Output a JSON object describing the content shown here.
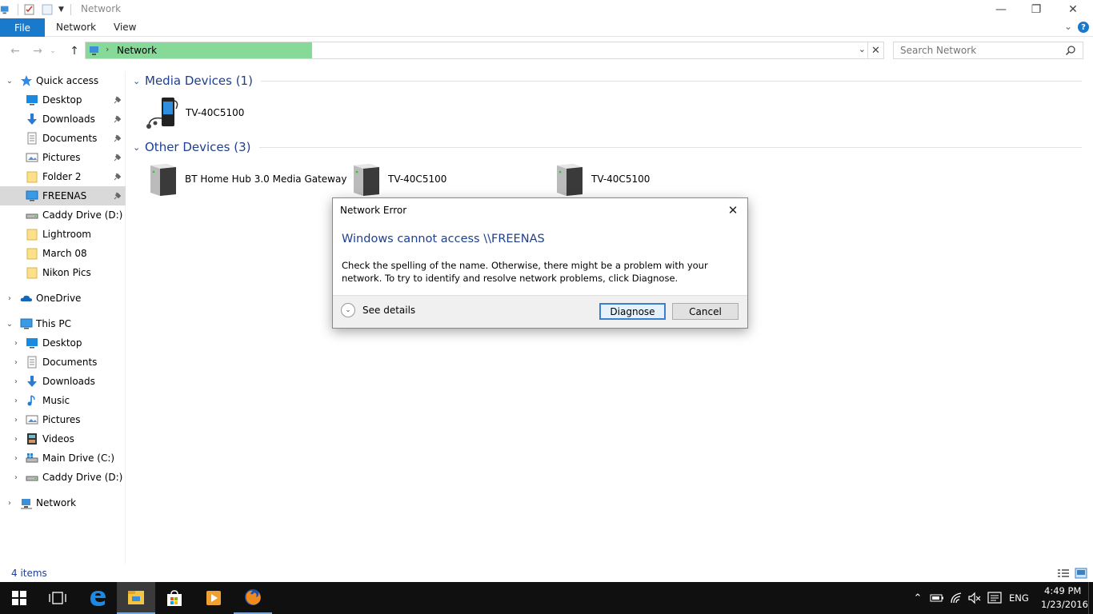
{
  "window": {
    "title": "Network",
    "minimize": "—",
    "maximize": "❐",
    "close": "✕"
  },
  "ribbon": {
    "tabs": [
      "File",
      "Network",
      "View"
    ]
  },
  "address": {
    "path": "Network",
    "search_placeholder": "Search Network"
  },
  "sidebar": {
    "quick_access": {
      "label": "Quick access",
      "items": [
        "Desktop",
        "Downloads",
        "Documents",
        "Pictures",
        "Folder 2",
        "FREENAS",
        "Caddy Drive (D:)",
        "Lightroom",
        "March 08",
        "Nikon Pics"
      ]
    },
    "onedrive": "OneDrive",
    "this_pc": {
      "label": "This PC",
      "items": [
        "Desktop",
        "Documents",
        "Downloads",
        "Music",
        "Pictures",
        "Videos",
        "Main Drive (C:)",
        "Caddy Drive (D:)"
      ]
    },
    "network": "Network"
  },
  "content": {
    "groups": [
      {
        "title": "Media Devices (1)",
        "devices": [
          "TV-40C5100"
        ]
      },
      {
        "title": "Other Devices (3)",
        "devices": [
          "BT Home Hub 3.0 Media Gateway",
          "TV-40C5100",
          "TV-40C5100"
        ]
      }
    ]
  },
  "status": {
    "items": "4 items"
  },
  "dialog": {
    "title": "Network Error",
    "heading": "Windows cannot access \\\\FREENAS",
    "body": "Check the spelling of the name. Otherwise, there might be a problem with your network. To try to identify and resolve network problems, click Diagnose.",
    "details": "See details",
    "diagnose": "Diagnose",
    "cancel": "Cancel"
  },
  "taskbar": {
    "language": "ENG",
    "time": "4:49 PM",
    "date": "1/23/2016"
  },
  "colors": {
    "accent": "#1979ca",
    "address_highlight": "#86d998",
    "heading_blue": "#1e3f8e",
    "taskbar": "#101010"
  }
}
